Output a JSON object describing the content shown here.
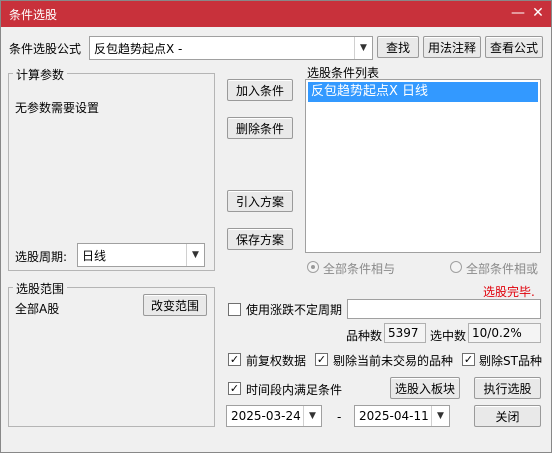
{
  "window": {
    "title": "条件选股",
    "close_glyph": "✕",
    "minimize_glyph": "—"
  },
  "formula": {
    "label": "条件选股公式",
    "value": "反包趋势起点X -",
    "find_button": "查找",
    "usage_button": "用法注释",
    "view_button": "查看公式"
  },
  "params": {
    "group_label": "计算参数",
    "message": "无参数需要设置",
    "period_label": "选股周期:",
    "period_value": "日线"
  },
  "actions": {
    "add": "加入条件",
    "delete": "删除条件",
    "import": "引入方案",
    "save": "保存方案"
  },
  "conditions": {
    "label": "选股条件列表",
    "items": [
      "反包趋势起点X  日线"
    ]
  },
  "logic": {
    "and_label": "全部条件相与",
    "or_label": "全部条件相或"
  },
  "status": {
    "text": "选股完毕.",
    "color": "#e0000a"
  },
  "range": {
    "group_label": "选股范围",
    "value": "全部A股",
    "change_button": "改变范围"
  },
  "options": {
    "limit_period_label": "使用涨跌不定周期",
    "limit_period_value": "",
    "count_label": "品种数",
    "count_value": "5397",
    "selected_label": "选中数",
    "selected_value": "10/0.2%",
    "adjust_label": "前复权数据",
    "exclude_suspended_label": "剔除当前未交易的品种",
    "exclude_st_label": "剔除ST品种",
    "time_range_label": "时间段内满足条件",
    "to_block_button": "选股入板块",
    "run_button": "执行选股",
    "start_date": "2025-03-24",
    "dash": "-",
    "end_date": "2025-04-11",
    "close_button": "关闭"
  }
}
